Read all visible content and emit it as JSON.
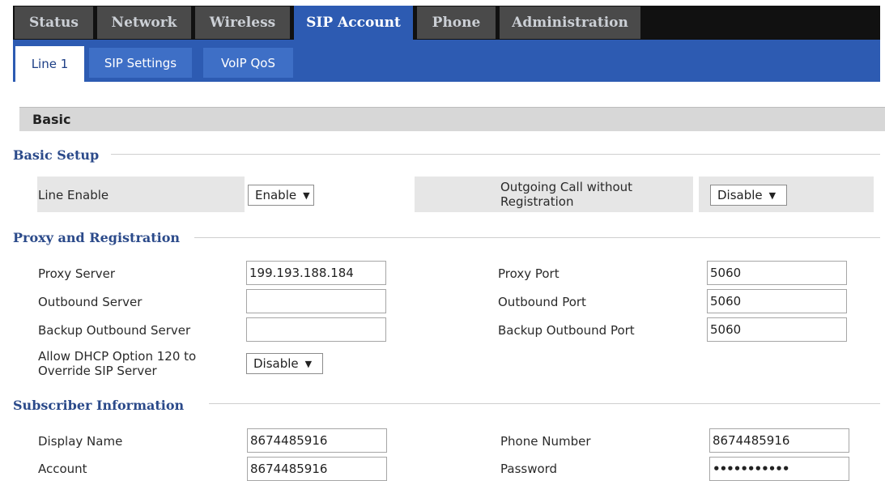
{
  "top_tabs": [
    "Status",
    "Network",
    "Wireless",
    "SIP Account",
    "Phone",
    "Administration"
  ],
  "sub_tabs": [
    "Line 1",
    "SIP Settings",
    "VoIP QoS"
  ],
  "panel_title": "Basic",
  "sections": {
    "basic_setup": "Basic Setup",
    "proxy_registration": "Proxy and Registration",
    "subscriber_information": "Subscriber Information"
  },
  "basic_setup": {
    "line_enable_label": "Line Enable",
    "line_enable_value": "Enable",
    "outgoing_label_1": "Outgoing Call without",
    "outgoing_label_2": "Registration",
    "outgoing_value": "Disable",
    "arrow": "▼"
  },
  "proxy": {
    "proxy_server_label": "Proxy Server",
    "proxy_server_value": "199.193.188.184",
    "proxy_port_label": "Proxy Port",
    "proxy_port_value": "5060",
    "outbound_server_label": "Outbound Server",
    "outbound_server_value": "",
    "outbound_port_label": "Outbound Port",
    "outbound_port_value": "5060",
    "backup_outbound_server_label": "Backup Outbound Server",
    "backup_outbound_server_value": "",
    "backup_outbound_port_label": "Backup Outbound Port",
    "backup_outbound_port_value": "5060",
    "dhcp_label_1": "Allow DHCP Option 120 to",
    "dhcp_label_2": "Override SIP Server",
    "dhcp_value": "Disable"
  },
  "subscriber": {
    "display_name_label": "Display Name",
    "display_name_value": "8674485916",
    "phone_number_label": "Phone Number",
    "phone_number_value": "8674485916",
    "account_label": "Account",
    "account_value": "8674485916",
    "password_label": "Password",
    "password_value": "•••••••••••"
  }
}
